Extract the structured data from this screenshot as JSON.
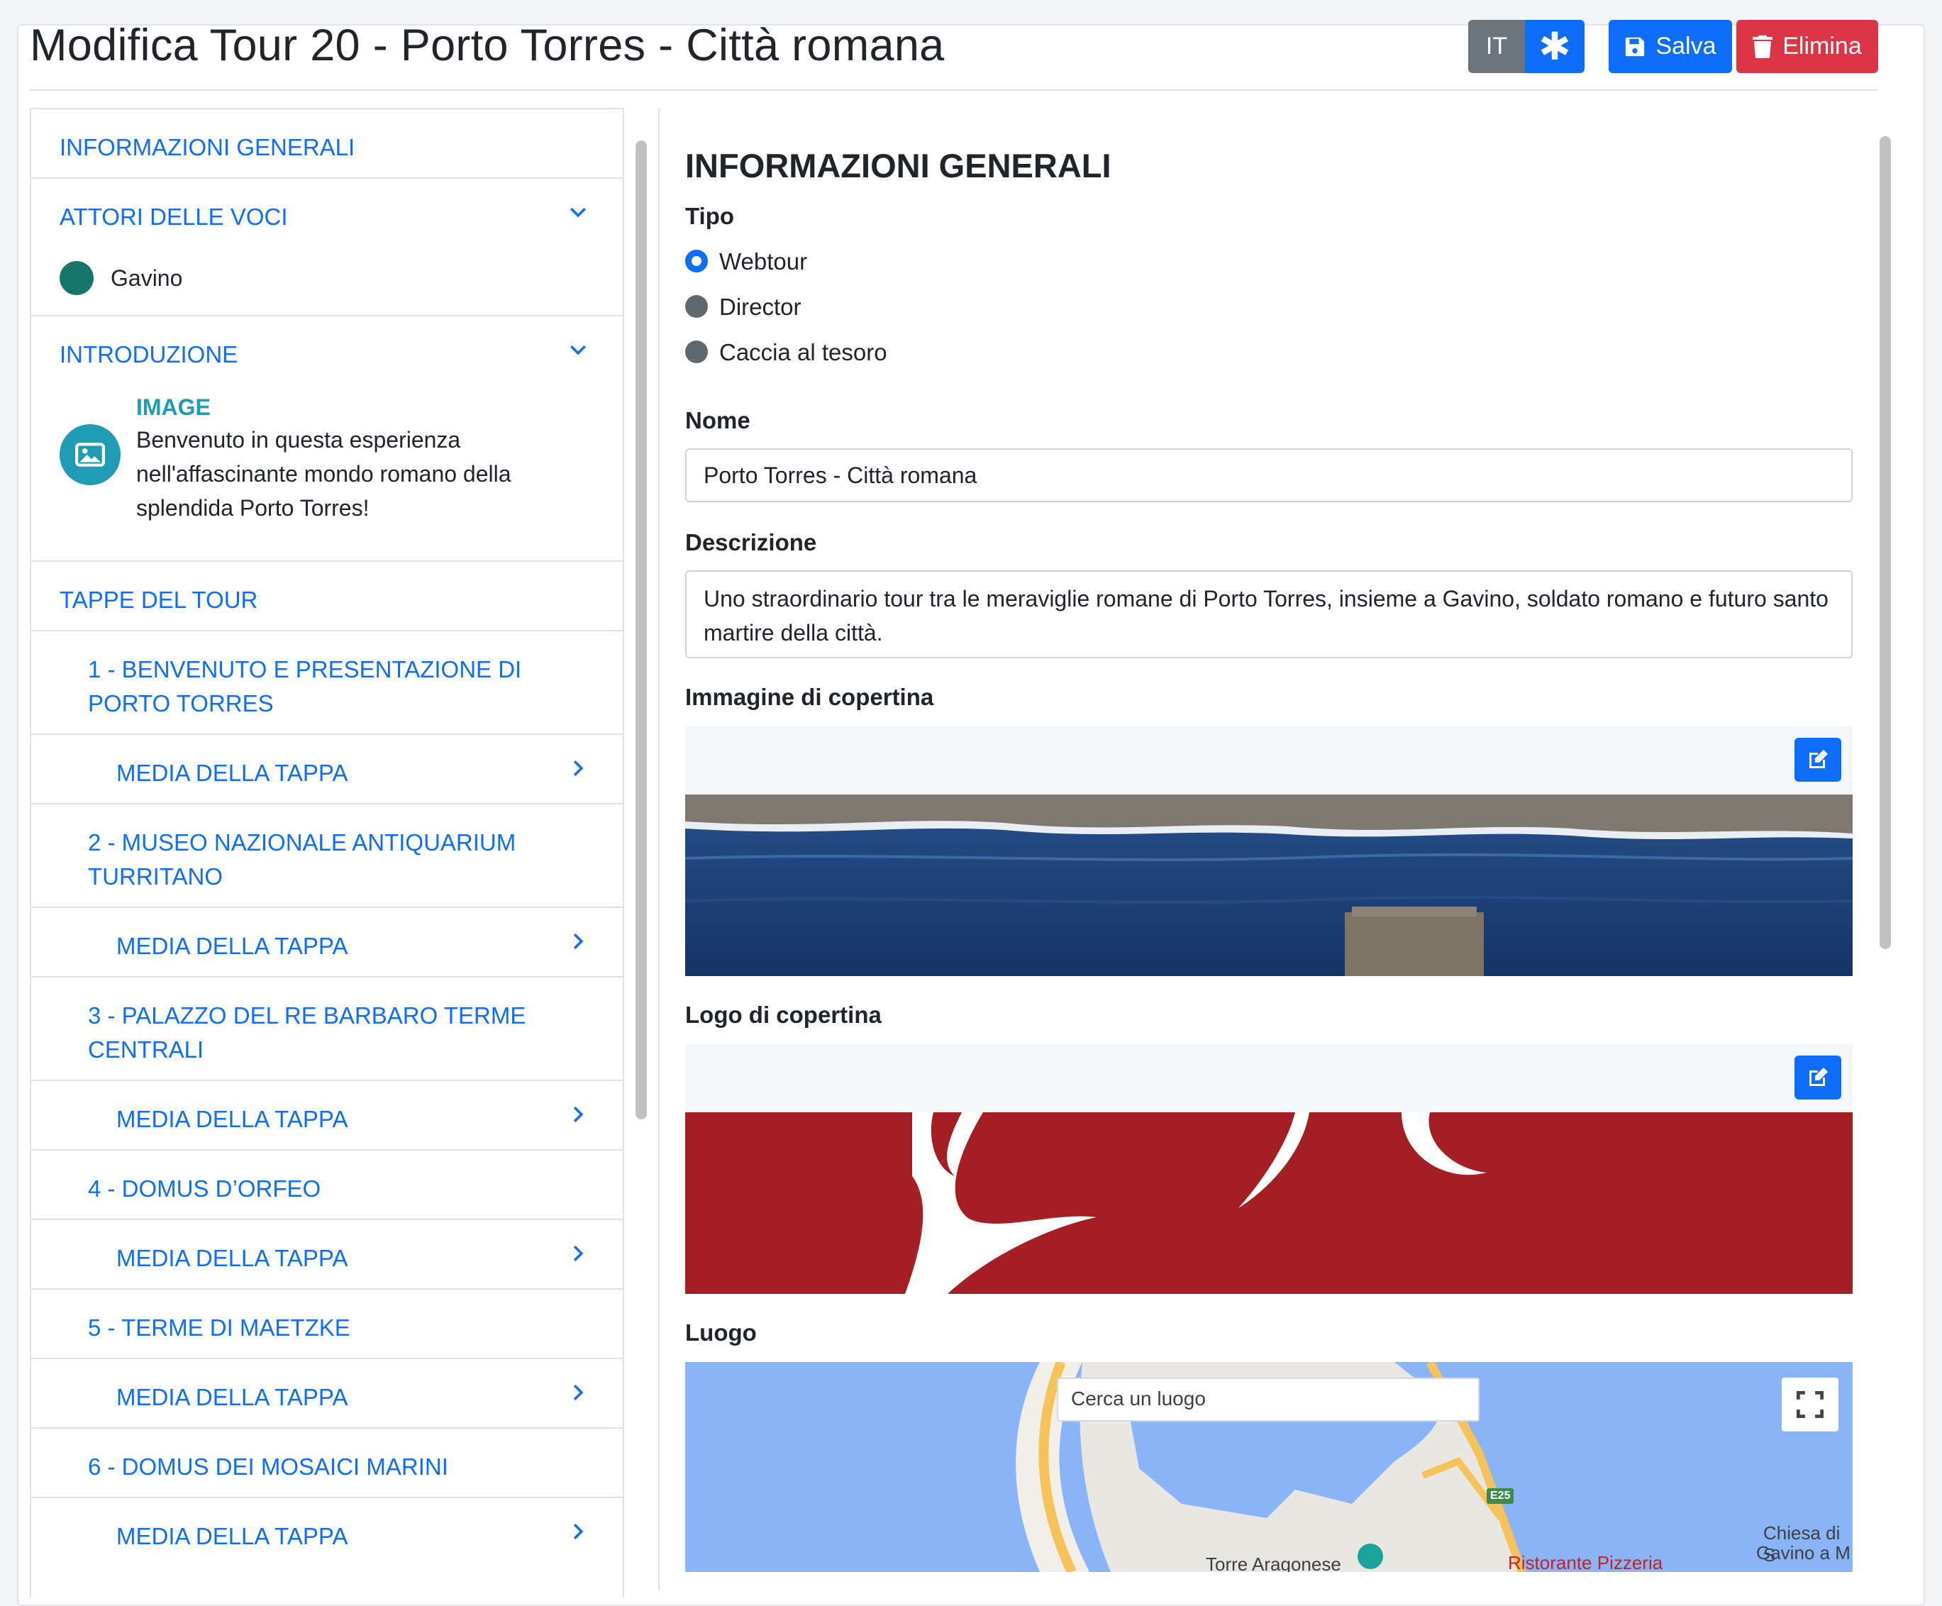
{
  "header": {
    "title": "Modifica Tour 20 - Porto Torres - Città romana",
    "lang_label": "IT",
    "save_label": "Salva",
    "delete_label": "Elimina"
  },
  "nav": {
    "general": "INFORMAZIONI GENERALI",
    "actors": "ATTORI DELLE VOCI",
    "actor_name": "Gavino",
    "intro": "INTRODUZIONE",
    "intro_type": "IMAGE",
    "intro_text": "Benvenuto in questa esperienza nell'affascinante mondo romano della splendida Porto Torres!",
    "stages": "TAPPE DEL TOUR",
    "stage_media_label": "MEDIA DELLA TAPPA",
    "stage_items": [
      "1 - BENVENUTO E PRESENTAZIONE DI PORTO TORRES",
      "2 - MUSEO NAZIONALE ANTIQUARIUM TURRITANO",
      "3 - PALAZZO DEL RE BARBARO TERME CENTRALI",
      "4 - DOMUS D’ORFEO",
      "5 - TERME DI MAETZKE",
      "6 - DOMUS DEI MOSAICI MARINI"
    ]
  },
  "form": {
    "section_title": "INFORMAZIONI GENERALI",
    "type_label": "Tipo",
    "type_options": [
      "Webtour",
      "Director",
      "Caccia al tesoro"
    ],
    "selected_type": "Webtour",
    "name_label": "Nome",
    "name_value": "Porto Torres - Città romana",
    "description_label": "Descrizione",
    "description_value": "Uno straordinario tour tra le meraviglie romane di Porto Torres, insieme a Gavino, soldato romano e futuro santo martire della città.",
    "cover_image_label": "Immagine di copertina",
    "cover_logo_label": "Logo di copertina",
    "place_label": "Luogo",
    "map_search_placeholder": "Cerca un luogo",
    "map_labels": [
      "E25",
      "Torre Aragonese",
      "Ristorante Pizzeria",
      "Chiesa di S",
      "Gavino a M"
    ]
  },
  "colors": {
    "primary": "#0d6efd",
    "danger": "#dc3545",
    "secondary": "#6c757d",
    "actor": "#17766a",
    "info": "#1f9bb4",
    "logo_red": "#a41f24"
  }
}
